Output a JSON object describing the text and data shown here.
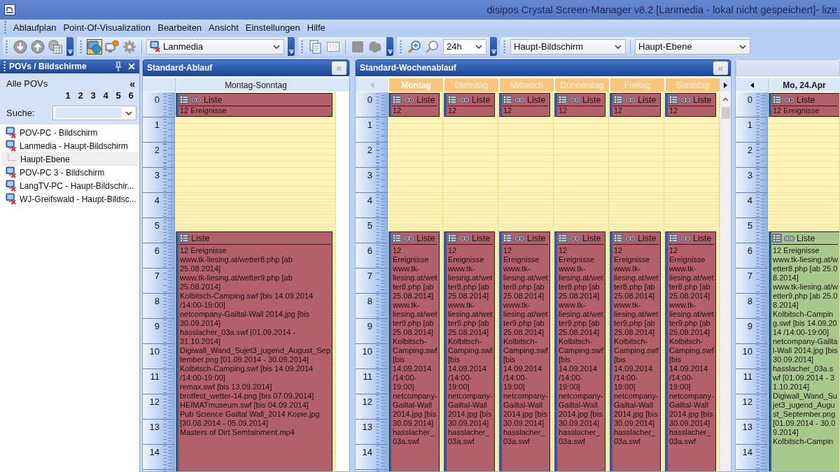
{
  "window": {
    "title": "disipos Crystal Screen-Manager v8.2 [Lanmedia - lokal nicht gespeichert]- lize"
  },
  "menu": [
    "Ablaufplan",
    "Point-Of-Visualization",
    "Bearbeiten",
    "Ansicht",
    "Einstellungen",
    "Hilfe"
  ],
  "toolbar": {
    "buttons": [
      {
        "pressed": false,
        "disabled": true
      },
      {
        "pressed": false,
        "disabled": true
      },
      {
        "pressed": false,
        "disabled": true
      },
      {
        "pressed": true,
        "disabled": false
      },
      {
        "pressed": false,
        "disabled": false
      },
      {
        "pressed": false,
        "disabled": true
      },
      {
        "pressed": false,
        "disabled": false
      },
      {
        "pressed": false,
        "disabled": true
      },
      {
        "pressed": false,
        "disabled": true
      },
      {
        "pressed": false,
        "disabled": true
      },
      {
        "pressed": false,
        "disabled": false
      },
      {
        "pressed": false,
        "disabled": true
      }
    ],
    "screen_select": {
      "value": "Lanmedia"
    },
    "zoom_select": {
      "value": "24h"
    },
    "display_select": {
      "value": "Haupt-Bildschirm"
    },
    "layer_select": {
      "value": "Haupt-Ebene"
    }
  },
  "sidebar": {
    "title": "POVs / Bildschirme",
    "filter_label": "Alle POVs",
    "collapse_button": "«",
    "levels": [
      "1",
      "2",
      "3",
      "4",
      "5",
      "6"
    ],
    "search": {
      "label": "Suche:"
    },
    "items": [
      {
        "label": "POV-PC - Bildschirm",
        "selected": false
      },
      {
        "label": "Lanmedia - Haupt-Bildschirm",
        "selected": false,
        "children": [
          {
            "label": "Haupt-Ebene",
            "selected": true
          }
        ]
      },
      {
        "label": "POV-PC 3 - Bildschirm",
        "selected": false
      },
      {
        "label": "LangTV-PC - Haupt-Bildschir...",
        "selected": false
      },
      {
        "label": "WJ-Greifswald - Haupt-Bildsc...",
        "selected": false
      }
    ]
  },
  "panels": [
    {
      "kind": "day",
      "title": "Standard-Ablauf",
      "active": true,
      "collapse_button": "«",
      "hours": [
        "0",
        "1",
        "2",
        "3",
        "4",
        "5",
        "6",
        "7",
        "8",
        "9",
        "10",
        "11",
        "12",
        "13",
        "14"
      ],
      "columns": [
        {
          "label": "Montag-Sonntag",
          "selected": false,
          "blocks": [
            {
              "title": "Liste",
              "linked": true,
              "color": "#b4606a",
              "summary": "12 Ereignisse"
            },
            {
              "title": "Liste",
              "linked": false,
              "color": "#b4606a",
              "summary": "12 Ereignisse",
              "entries": [
                "www.tk-liesing.at/wetter8.php [ab 25.08.2014]",
                "www.tk-liesing.at/wetter9.php [ab 25.08.2014]",
                "Kolbitsch-Camping.swf [bis 14.09.2014 /14:00-19:00]",
                "netcompany-Gailtal-Wall 2014.jpg [bis 30.09.2014]",
                "hasslacher_03a.swf [01.09.2014 - 31.10.2014]",
                "Digiwall_Wand_Sujet3_jugend_August_September.png [01.09.2014 - 30.09.2014]",
                "Kolbitsch-Camping.swf [bis 14.09.2014 /14:00-19:00]",
                "remax.swf [bis 13.09.2014]",
                "brotfest_wetter-14.png [bis 07.09.2014]",
                "HEIMATmuseum.swf [bis 04.09.2014]",
                "Pub Science Gailtal Wall_2014 Kopie.jpg [30.08.2014 - 05.09.2014]",
                "Masters of Dirt Semtainment.mp4"
              ]
            }
          ]
        }
      ]
    },
    {
      "kind": "week",
      "title": "Standard-Wochenablauf",
      "active": true,
      "collapse_button": "«",
      "nav_left": {
        "disabled": true
      },
      "nav_right": {
        "disabled": false
      },
      "scrollbar": true,
      "hours": [
        "0",
        "1",
        "2",
        "3",
        "4",
        "5",
        "6",
        "7",
        "8",
        "9",
        "10",
        "11",
        "12",
        "13",
        "14"
      ],
      "columns": [
        {
          "label": "Montag",
          "selected": true,
          "blocks": [
            {
              "title": "Liste",
              "linked": true,
              "color": "#b4606a",
              "summary": "12"
            },
            {
              "title": "Liste",
              "linked": true,
              "color": "#b4606a",
              "summary": "12 Ereignisse",
              "entries": [
                "www.tk-liesing.at/wetter8.php [ab 25.08.2014]",
                "www.tk-liesing.at/wetter9.php [ab 25.08.2014]",
                "Kolbitsch-Camping.swf [bis 14.09.2014 /14:00-19:00]",
                "netcompany-Gailtal-Wall 2014.jpg [bis 30.09.2014]",
                "hasslacher_03a.swf"
              ]
            }
          ]
        },
        {
          "label": "Dienstag",
          "selected": false,
          "blocks": [
            {
              "title": "Liste",
              "linked": true,
              "color": "#b4606a",
              "summary": "12"
            },
            {
              "title": "Liste",
              "linked": true,
              "color": "#b4606a",
              "summary": "12 Ereignisse",
              "entries": [
                "www.tk-liesing.at/wetter8.php [ab 25.08.2014]",
                "www.tk-liesing.at/wetter9.php [ab 25.08.2014]",
                "Kolbitsch-Camping.swf [bis 14.09.2014 /14:00-19:00]",
                "netcompany-Gailtal-Wall 2014.jpg [bis 30.09.2014]",
                "hasslacher_03a.swf"
              ]
            }
          ]
        },
        {
          "label": "Mittwoch",
          "selected": false,
          "blocks": [
            {
              "title": "Liste",
              "linked": true,
              "color": "#b4606a",
              "summary": "12"
            },
            {
              "title": "Liste",
              "linked": true,
              "color": "#b4606a",
              "summary": "12 Ereignisse",
              "entries": [
                "www.tk-liesing.at/wetter8.php [ab 25.08.2014]",
                "www.tk-liesing.at/wetter9.php [ab 25.08.2014]",
                "Kolbitsch-Camping.swf [bis 14.09.2014 /14:00-19:00]",
                "netcompany-Gailtal-Wall 2014.jpg [bis 30.09.2014]",
                "hasslacher_03a.swf"
              ]
            }
          ]
        },
        {
          "label": "Donnerstag",
          "selected": false,
          "blocks": [
            {
              "title": "Liste",
              "linked": true,
              "color": "#b4606a",
              "summary": "12"
            },
            {
              "title": "Liste",
              "linked": true,
              "color": "#b4606a",
              "summary": "12 Ereignisse",
              "entries": [
                "www.tk-liesing.at/wetter8.php [ab 25.08.2014]",
                "www.tk-liesing.at/wetter9.php [ab 25.08.2014]",
                "Kolbitsch-Camping.swf [bis 14.09.2014 /14:00-19:00]",
                "netcompany-Gailtal-Wall 2014.jpg [bis 30.09.2014]",
                "hasslacher_03a.swf"
              ]
            }
          ]
        },
        {
          "label": "Freitag",
          "selected": false,
          "blocks": [
            {
              "title": "Liste",
              "linked": true,
              "color": "#b4606a",
              "summary": "12"
            },
            {
              "title": "Liste",
              "linked": true,
              "color": "#b4606a",
              "summary": "12 Ereignisse",
              "entries": [
                "www.tk-liesing.at/wetter8.php [ab 25.08.2014]",
                "www.tk-liesing.at/wetter9.php [ab 25.08.2014]",
                "Kolbitsch-Camping.swf [bis 14.09.2014 /14:00-19:00]",
                "netcompany-Gailtal-Wall 2014.jpg [bis 30.09.2014]",
                "hasslacher_03a.swf"
              ]
            }
          ]
        },
        {
          "label": "Samstag",
          "selected": false,
          "blocks": [
            {
              "title": "Liste",
              "linked": true,
              "color": "#b4606a",
              "summary": "12"
            },
            {
              "title": "Liste",
              "linked": true,
              "color": "#b4606a",
              "summary": "12 Ereignisse",
              "entries": [
                "www.tk-liesing.at/wetter8.php [ab 25.08.2014]",
                "www.tk-liesing.at/wetter9.php [ab 25.08.2014]",
                "Kolbitsch-Camping.swf [bis 14.09.2014 /14:00-19:00]",
                "netcompany-Gailtal-Wall 2014.jpg [bis 30.09.2014]",
                "hasslacher_03a.swf"
              ]
            }
          ]
        }
      ]
    },
    {
      "kind": "date",
      "active": false,
      "nav_left": {
        "disabled": false
      },
      "hours": [
        "0",
        "1",
        "2",
        "3",
        "4",
        "5",
        "6",
        "7",
        "8",
        "9",
        "10",
        "11",
        "12",
        "13",
        "14"
      ],
      "columns": [
        {
          "label": "Mo, 24.Apr",
          "selected": true,
          "blocks": [
            {
              "title": "Liste",
              "linked": true,
              "color": "#b4606a",
              "summary": "12 Ereignisse"
            },
            {
              "title": "Liste",
              "linked": true,
              "color": "#a8c98e",
              "summary": "12 Ereignisse",
              "entries": [
                "www.tk-liesing.at/wetter8.php [ab 25.08.2014]",
                "www.tk-liesing.at/wetter9.php [ab 25.08.2014]",
                "Kolbitsch-Camping.swf [bis 14.09.2014 /14:00-19:00]",
                "netcompany-Gailtal-Wall 2014.jpg [bis 30.09.2014]",
                "hasslacher_03a.swf [01.09.2014 - 31.10.2014]",
                "Digiwall_Wand_Sujet3_jugend_August_September.png [01.09.2014 - 30.09.2014]",
                "Kolbitsch-Campin"
              ]
            }
          ]
        }
      ]
    }
  ]
}
